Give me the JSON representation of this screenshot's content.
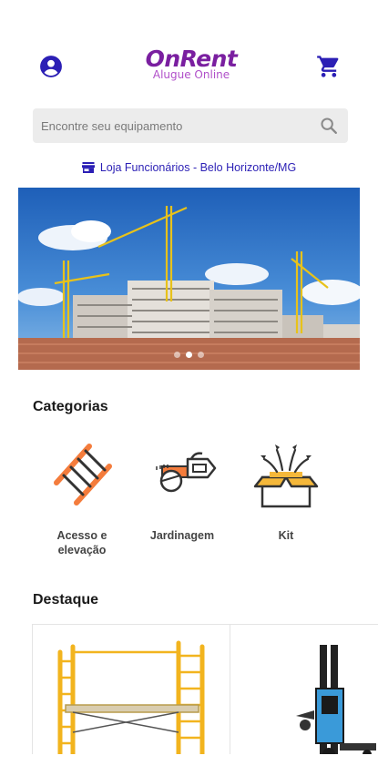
{
  "header": {
    "logo_main": "OnRent",
    "logo_sub": "Alugue Online",
    "account_icon": "account-circle-icon",
    "cart_icon": "shopping-cart-icon"
  },
  "search": {
    "placeholder": "Encontre seu equipamento",
    "value": "",
    "icon": "search-icon"
  },
  "store": {
    "label": "Loja Funcionários - Belo Horizonte/MG",
    "icon": "store-icon"
  },
  "banner": {
    "image": "construction-site-cranes",
    "slides": 3,
    "active_slide": 1
  },
  "categories": {
    "title": "Categorias",
    "items": [
      {
        "label": "Acesso e elevação",
        "icon": "ladder-icon"
      },
      {
        "label": "Jardinagem",
        "icon": "chainsaw-icon"
      },
      {
        "label": "Kit",
        "icon": "open-box-icon"
      }
    ]
  },
  "featured": {
    "title": "Destaque",
    "items": [
      {
        "image": "scaffolding-product"
      },
      {
        "image": "electric-stacker-product"
      }
    ]
  },
  "colors": {
    "brand_purple": "#7a1fa0",
    "brand_blue": "#2b1fb5",
    "accent_orange": "#f47c3c"
  }
}
